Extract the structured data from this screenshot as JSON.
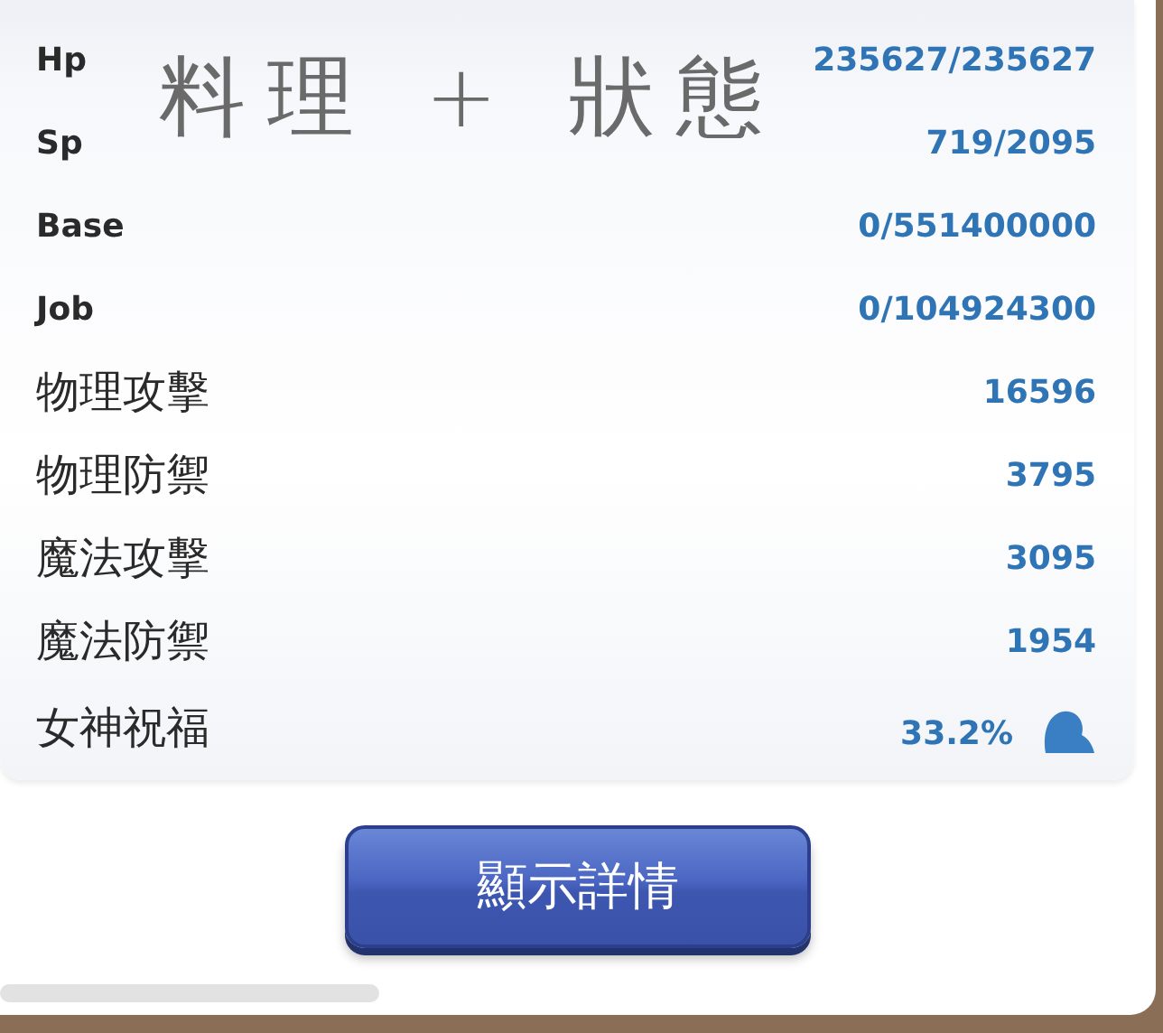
{
  "annotation": "料理 + 狀態",
  "stats": [
    {
      "kind": "stat",
      "label": "Hp",
      "value": "235627/235627"
    },
    {
      "kind": "stat",
      "label": "Sp",
      "value": "719/2095"
    },
    {
      "kind": "stat",
      "label": "Base",
      "value": "0/551400000"
    },
    {
      "kind": "stat",
      "label": "Job",
      "value": "0/104924300"
    },
    {
      "kind": "attribute",
      "label": "物理攻擊",
      "value": "16596"
    },
    {
      "kind": "attribute",
      "label": "物理防禦",
      "value": "3795"
    },
    {
      "kind": "attribute",
      "label": "魔法攻擊",
      "value": "3095"
    },
    {
      "kind": "attribute",
      "label": "魔法防禦",
      "value": "1954"
    },
    {
      "kind": "blessing",
      "label": "女神祝福",
      "value": "33.2%"
    }
  ],
  "button": "顯示詳情"
}
